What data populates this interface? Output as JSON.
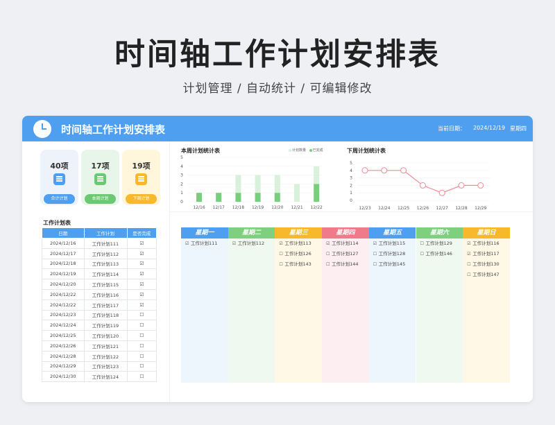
{
  "hero": {
    "title": "时间轴工作计划安排表",
    "subtitle": "计划管理 / 自动统计 / 可编辑修改"
  },
  "header": {
    "title": "时间轴工作计划安排表",
    "date_label": "当前日期：",
    "date_value": "2024/12/19",
    "weekday": "星期四"
  },
  "stats": [
    {
      "value": "40项",
      "label": "合计计划",
      "bg": "#eef2fb",
      "accent": "#4e9ff0"
    },
    {
      "value": "17项",
      "label": "本周计划",
      "bg": "#e8f6ea",
      "accent": "#6cc872"
    },
    {
      "value": "19项",
      "label": "下周计划",
      "bg": "#fff6dc",
      "accent": "#f7b82b"
    }
  ],
  "charts": {
    "this_week_title": "本周计划统计表",
    "next_week_title": "下周计划统计表",
    "legend": {
      "total": "计划数量",
      "done": "已完成"
    }
  },
  "chart_data": [
    {
      "type": "bar",
      "title": "本周计划统计表",
      "categories": [
        "12/16",
        "12/17",
        "12/18",
        "12/19",
        "12/20",
        "12/21",
        "12/22"
      ],
      "series": [
        {
          "name": "计划数量",
          "values": [
            1,
            1,
            3,
            3,
            3,
            2,
            4
          ]
        },
        {
          "name": "已完成",
          "values": [
            1,
            1,
            1,
            1,
            1,
            0,
            2
          ]
        }
      ],
      "ylim": [
        0,
        5
      ],
      "yticks": [
        0,
        1,
        2,
        3,
        4,
        5
      ],
      "colors": {
        "total": "#d9f0da",
        "done": "#77cf7c"
      }
    },
    {
      "type": "line",
      "title": "下周计划统计表",
      "categories": [
        "12/23",
        "12/24",
        "12/25",
        "12/26",
        "12/27",
        "12/28",
        "12/29"
      ],
      "values": [
        4,
        4,
        4,
        2,
        1,
        2,
        2
      ],
      "ylim": [
        0,
        5
      ],
      "yticks": [
        0,
        1,
        2,
        3,
        4,
        5
      ],
      "color": "#f08a96"
    }
  ],
  "plan_table": {
    "title": "工作计划表",
    "columns": [
      "日期",
      "工作计划",
      "是否完成"
    ],
    "rows": [
      [
        "2024/12/16",
        "工作计划111",
        "☑"
      ],
      [
        "2024/12/17",
        "工作计划112",
        "☑"
      ],
      [
        "2024/12/18",
        "工作计划113",
        "☑"
      ],
      [
        "2024/12/19",
        "工作计划114",
        "☑"
      ],
      [
        "2024/12/20",
        "工作计划115",
        "☑"
      ],
      [
        "2024/12/22",
        "工作计划116",
        "☑"
      ],
      [
        "2024/12/22",
        "工作计划117",
        "☑"
      ],
      [
        "2024/12/23",
        "工作计划118",
        "☐"
      ],
      [
        "2024/12/24",
        "工作计划119",
        "☐"
      ],
      [
        "2024/12/25",
        "工作计划120",
        "☐"
      ],
      [
        "2024/12/26",
        "工作计划121",
        "☐"
      ],
      [
        "2024/12/28",
        "工作计划122",
        "☐"
      ],
      [
        "2024/12/29",
        "工作计划123",
        "☐"
      ],
      [
        "2024/12/30",
        "工作计划124",
        "☐"
      ]
    ]
  },
  "week_board": [
    {
      "day": "星期一",
      "color": "#4e9ff0",
      "tint": "#edf5fd",
      "tasks": [
        [
          "☑",
          "工作计划111"
        ]
      ]
    },
    {
      "day": "星期二",
      "color": "#7ed07f",
      "tint": "#eff9ef",
      "tasks": [
        [
          "☑",
          "工作计划112"
        ]
      ]
    },
    {
      "day": "星期三",
      "color": "#f7b82b",
      "tint": "#fff8e6",
      "tasks": [
        [
          "☑",
          "工作计划113"
        ],
        [
          "☐",
          "工作计划126"
        ],
        [
          "☐",
          "工作计划143"
        ]
      ]
    },
    {
      "day": "星期四",
      "color": "#f17a8a",
      "tint": "#fdeff1",
      "tasks": [
        [
          "☑",
          "工作计划114"
        ],
        [
          "☐",
          "工作计划127"
        ],
        [
          "☐",
          "工作计划144"
        ]
      ]
    },
    {
      "day": "星期五",
      "color": "#4e9ff0",
      "tint": "#edf5fd",
      "tasks": [
        [
          "☑",
          "工作计划115"
        ],
        [
          "☐",
          "工作计划128"
        ],
        [
          "☐",
          "工作计划145"
        ]
      ]
    },
    {
      "day": "星期六",
      "color": "#7ed07f",
      "tint": "#eff9ef",
      "tasks": [
        [
          "☐",
          "工作计划129"
        ],
        [
          "☐",
          "工作计划146"
        ]
      ]
    },
    {
      "day": "星期日",
      "color": "#f7b82b",
      "tint": "#fff8e6",
      "tasks": [
        [
          "☑",
          "工作计划116"
        ],
        [
          "☑",
          "工作计划117"
        ],
        [
          "☐",
          "工作计划130"
        ],
        [
          "☐",
          "工作计划147"
        ]
      ]
    }
  ]
}
